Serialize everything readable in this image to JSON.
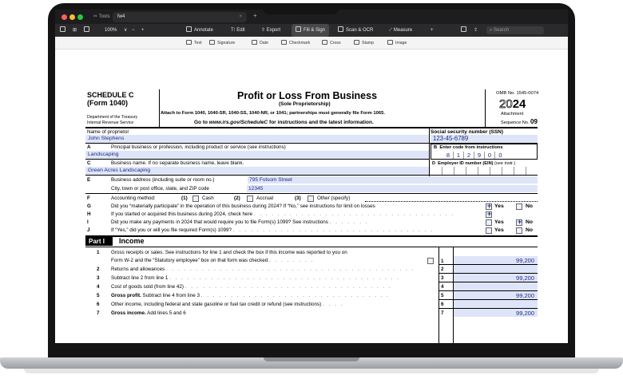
{
  "window": {
    "tabs": [
      {
        "label": "Tools"
      },
      {
        "label": "fw4"
      }
    ]
  },
  "toolbar": {
    "zoom": "100%",
    "items": [
      "Annotate",
      "Edit",
      "Export",
      "Fill & Sign",
      "Scan & OCR",
      "Measure"
    ],
    "search_placeholder": "Search"
  },
  "fill_tools": [
    "Text",
    "Signature",
    "Date",
    "Checkmark",
    "Cross",
    "Stamp",
    "Image"
  ],
  "form": {
    "header": {
      "schedule": "SCHEDULE C",
      "form_ref": "(Form 1040)",
      "dept_line1": "Department of the Treasury",
      "dept_line2": "Internal Revenue Service",
      "title": "Profit or Loss From Business",
      "subtitle": "(Sole Proprietorship)",
      "attach": "Attach to Form 1040, 1040-SR, 1040-SS, 1040-NR, or 1041; partnerships must generally file Form 1065.",
      "goto_pre": "Go to ",
      "goto_url": "www.irs.gov/ScheduleC",
      "goto_post": " for instructions and the latest information.",
      "omb": "OMB No. 1545-0074",
      "year_light": "20",
      "year_bold": "24",
      "attachment": "Attachment",
      "sequence_label": "Sequence No.",
      "sequence_no": "09"
    },
    "proprietor_label": "Name of proprietor",
    "proprietor_value": "John Stephens",
    "ssn_label": "Social security number (SSN)",
    "ssn_value": "123-45-6789",
    "line_a": {
      "letter": "A",
      "label": "Principal business or profession, including product or service (see instructions)",
      "value": "Landscaping"
    },
    "line_b": {
      "letter": "B",
      "label": "Enter code from instructions",
      "digits": [
        "8",
        "1",
        "2",
        "9",
        "0",
        "0"
      ]
    },
    "line_c": {
      "letter": "C",
      "label": "Business name. If no separate business name, leave blank.",
      "value": "Green Acres Landscaping"
    },
    "line_d": {
      "letter": "D",
      "label": "Employer ID number (EIN)",
      "hint": "(see instr.)"
    },
    "line_e": {
      "letter": "E",
      "label1": "Business address (including suite or room no.)",
      "value1": "795 Folsom Street",
      "label2": "City, town or post office, state, and ZIP code",
      "value2": "12345"
    },
    "line_f": {
      "letter": "F",
      "label": "Accounting method:",
      "opt1_num": "(1)",
      "opt1": "Cash",
      "opt2_num": "(2)",
      "opt2": "Accrual",
      "opt3_num": "(3)",
      "opt3": "Other (specify)"
    },
    "line_g": {
      "letter": "G",
      "label": "Did you “materially participate” in the operation of this business during 2024? If “No,” see instructions for limit on losses",
      "yes": "Yes",
      "no": "No"
    },
    "line_h": {
      "letter": "H",
      "label": "If you started or acquired this business during 2024, check here"
    },
    "line_i": {
      "letter": "I",
      "label": "Did you make any payments in 2024 that would require you to file Form(s) 1099? See instructions",
      "yes": "Yes",
      "no": "No"
    },
    "line_j": {
      "letter": "J",
      "label": "If “Yes,” did you or will you file required Form(s) 1099?",
      "yes": "Yes",
      "no": "No"
    },
    "part_label": "Part I",
    "part_title": "Income",
    "income_lines": [
      {
        "num": "1",
        "label": "Gross receipts or sales. See instructions for line 1 and check the box if this income was reported to you on",
        "label2": "Form W-2 and the “Statutory employee” box on that form was checked",
        "box": "1",
        "amount": "99,200"
      },
      {
        "num": "2",
        "label": "Returns and allowances",
        "box": "2",
        "amount": ""
      },
      {
        "num": "3",
        "label": "Subtract line 2 from line 1",
        "box": "3",
        "amount": "99,200"
      },
      {
        "num": "4",
        "label": "Cost of goods sold (from line 42)",
        "box": "4",
        "amount": ""
      },
      {
        "num": "5",
        "label_bold": "Gross profit.",
        "label": " Subtract line 4 from line 3",
        "box": "5",
        "amount": "99,200"
      },
      {
        "num": "6",
        "label": "Other income, including federal and state gasoline or fuel tax credit or refund (see instructions)",
        "box": "6",
        "amount": ""
      },
      {
        "num": "7",
        "label_bold": "Gross income.",
        "label": " Add lines 5 and 6",
        "box": "7",
        "amount": "99,200"
      }
    ]
  }
}
